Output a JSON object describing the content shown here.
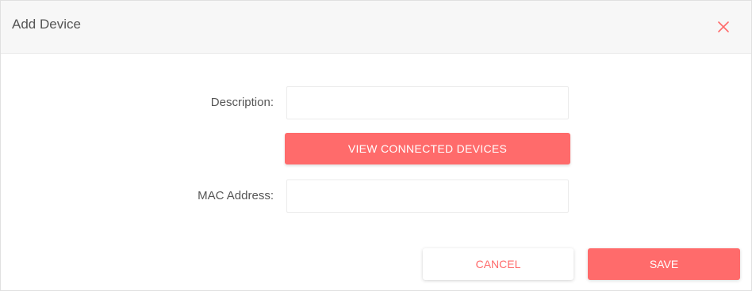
{
  "dialog": {
    "title": "Add Device",
    "close_icon": "close-icon"
  },
  "form": {
    "description": {
      "label": "Description:",
      "value": "",
      "placeholder": ""
    },
    "view_connected_label": "VIEW CONNECTED DEVICES",
    "mac": {
      "label": "MAC Address:",
      "value": "",
      "placeholder": ""
    }
  },
  "footer": {
    "cancel_label": "CANCEL",
    "save_label": "SAVE"
  },
  "colors": {
    "accent": "#ff6b6b",
    "header_bg": "#f7f7f7",
    "label_text": "#555555"
  }
}
